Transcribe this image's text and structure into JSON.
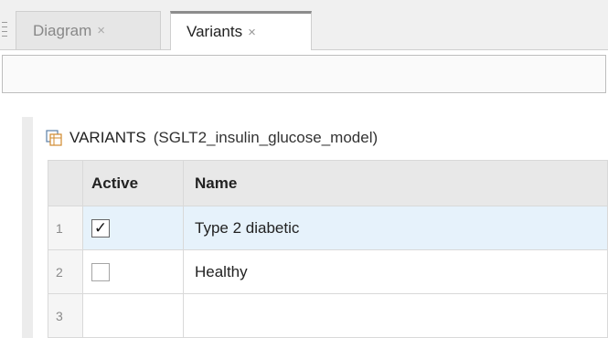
{
  "tabs": [
    {
      "label": "Diagram",
      "close": "×",
      "active": false
    },
    {
      "label": "Variants",
      "close": "×",
      "active": true
    }
  ],
  "section": {
    "icon": "variants-table-icon",
    "heading": "VARIANTS",
    "model": "(SGLT2_insulin_glucose_model)"
  },
  "table": {
    "columns": [
      "Active",
      "Name"
    ],
    "rows": [
      {
        "index": "1",
        "active": true,
        "check_glyph": "✓",
        "name": "Type 2 diabetic"
      },
      {
        "index": "2",
        "active": false,
        "check_glyph": "",
        "name": "Healthy"
      },
      {
        "index": "3",
        "active": null,
        "check_glyph": "",
        "name": ""
      }
    ]
  },
  "colors": {
    "selected_row": "#e6f2fb",
    "header_bg": "#e8e8e8"
  }
}
